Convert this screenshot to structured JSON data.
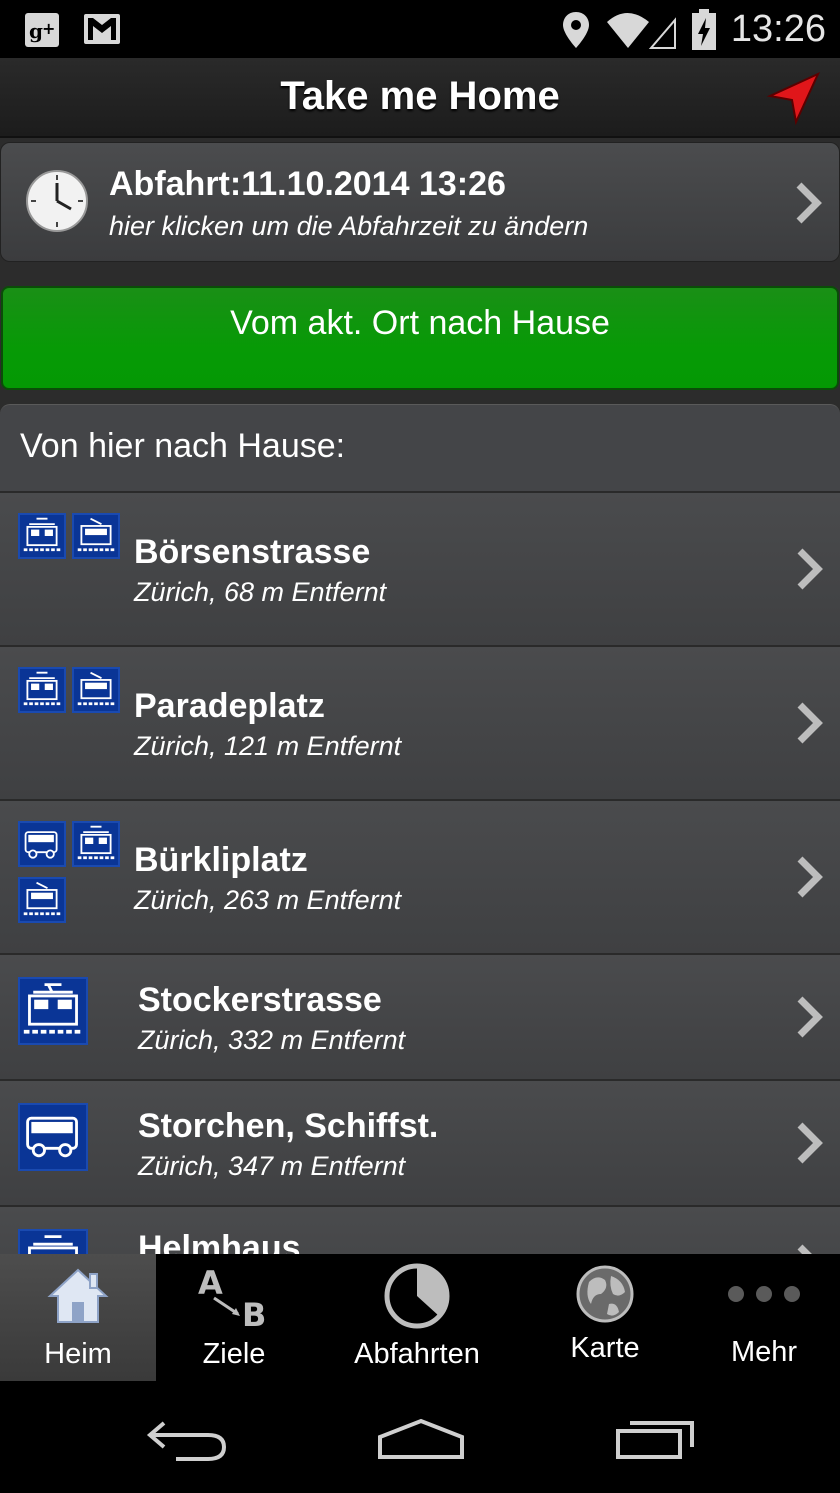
{
  "status_bar": {
    "time": "13:26",
    "left_icons": [
      "google-plus-icon",
      "gmail-icon"
    ],
    "right_icons": [
      "location-icon",
      "wifi-icon",
      "battery-charging-icon"
    ]
  },
  "action_bar": {
    "title": "Take me Home",
    "locate_icon": "location-arrow-icon",
    "accent_color": "#e0161a"
  },
  "departure": {
    "title": "Abfahrt:11.10.2014 13:26",
    "subtitle": "hier klicken um die Abfahrzeit zu ändern"
  },
  "primary_button": {
    "label": "Vom akt. Ort nach Hause",
    "color": "#079a06"
  },
  "list": {
    "header": "Von hier nach Hause:",
    "items": [
      {
        "name": "Börsenstrasse",
        "detail": "Zürich, 68 m Entfernt",
        "icons": [
          "tram-icon",
          "tram-icon"
        ]
      },
      {
        "name": "Paradeplatz",
        "detail": "Zürich, 121 m Entfernt",
        "icons": [
          "tram-icon",
          "tram-icon"
        ]
      },
      {
        "name": "Bürkliplatz",
        "detail": "Zürich, 263 m Entfernt",
        "icons": [
          "bus-icon",
          "tram-icon",
          "tram-icon"
        ]
      },
      {
        "name": "Stockerstrasse",
        "detail": "Zürich, 332 m Entfernt",
        "icons": [
          "tram-icon"
        ]
      },
      {
        "name": "Storchen, Schiffst.",
        "detail": "Zürich, 347 m Entfernt",
        "icons": [
          "bus-icon"
        ]
      },
      {
        "name": "Helmhaus",
        "detail": "",
        "icons": [
          "tram-icon"
        ]
      }
    ]
  },
  "bottom_nav": {
    "items": [
      {
        "label": "Heim",
        "icon": "home-icon",
        "active": true
      },
      {
        "label": "Ziele",
        "icon": "a-to-b-icon",
        "active": false
      },
      {
        "label": "Abfahrten",
        "icon": "departures-clock-icon",
        "active": false
      },
      {
        "label": "Karte",
        "icon": "globe-icon",
        "active": false
      },
      {
        "label": "Mehr",
        "icon": "more-dots-icon",
        "active": false
      }
    ]
  },
  "system_nav": {
    "icons": [
      "back-icon",
      "home-outline-icon",
      "recents-icon"
    ]
  }
}
